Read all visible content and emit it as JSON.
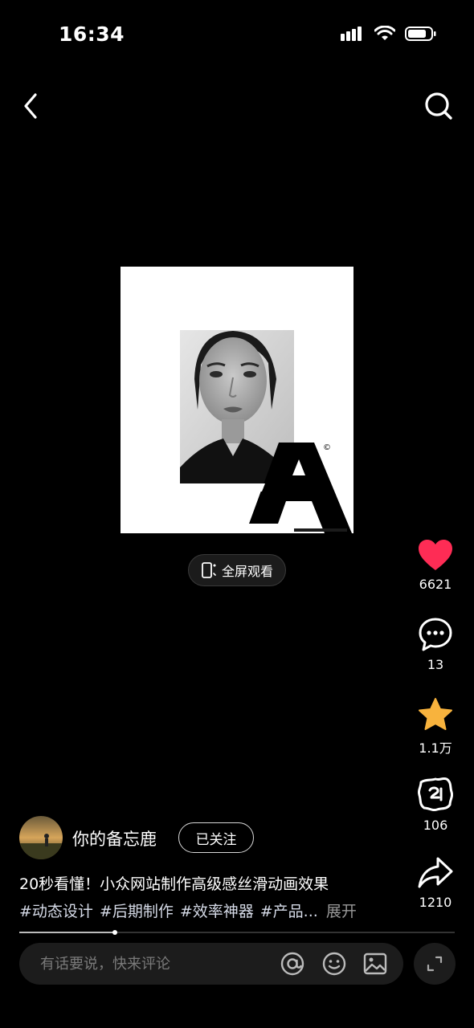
{
  "status_bar": {
    "time": "16:34"
  },
  "video": {
    "fullscreen_label": "全屏观看",
    "logo_mark": "©"
  },
  "actions": {
    "like_count": "6621",
    "comment_count": "13",
    "favorite_count": "1.1万",
    "co_create_count": "106",
    "share_count": "1210"
  },
  "author": {
    "name": "你的备忘鹿",
    "follow_label": "已关注"
  },
  "caption": "20秒看懂！小众网站制作高级感丝滑动画效果",
  "tags": [
    "#动态设计",
    "#后期制作",
    "#效率神器",
    "#产品..."
  ],
  "expand_label": "展开",
  "playback_progress": 0.22,
  "comment": {
    "placeholder": "有话要说，快来评论"
  },
  "colors": {
    "like": "#fe2c55",
    "favorite": "#f8b33d",
    "background": "#000000"
  },
  "icons": [
    "back-icon",
    "search-icon",
    "heart-icon",
    "comment-icon",
    "star-icon",
    "co-create-icon",
    "share-icon",
    "at-icon",
    "emoji-icon",
    "image-icon",
    "expand-icon",
    "fullscreen-phone-icon"
  ]
}
